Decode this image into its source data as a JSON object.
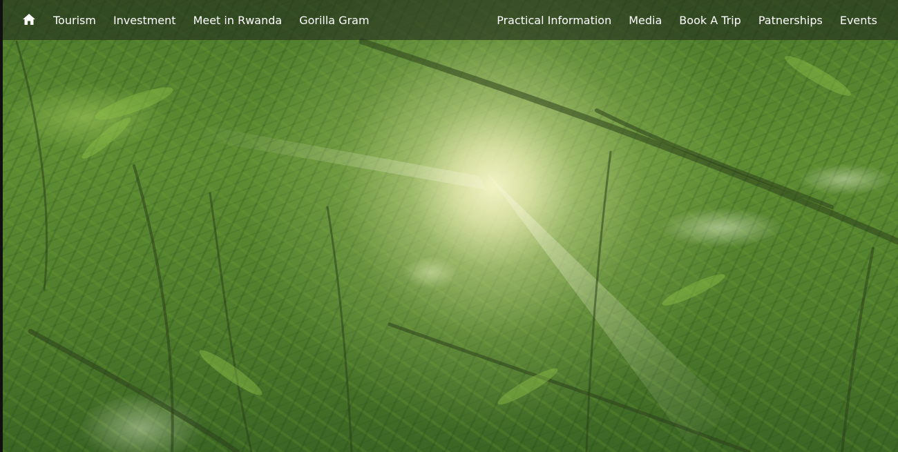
{
  "nav": {
    "home_icon": "home-icon",
    "left_items": [
      "Tourism",
      "Investment",
      "Meet in Rwanda",
      "Gorilla Gram"
    ],
    "right_items": [
      "Practical Information",
      "Media",
      "Book A Trip",
      "Patnerships",
      "Events"
    ]
  },
  "hero": {
    "image": "forest-canopy-sunlight"
  },
  "colors": {
    "nav_background": "#232d1e",
    "nav_text": "#ffffff",
    "foliage": "#5e8d33",
    "sun_glow": "#f5f5c8"
  }
}
